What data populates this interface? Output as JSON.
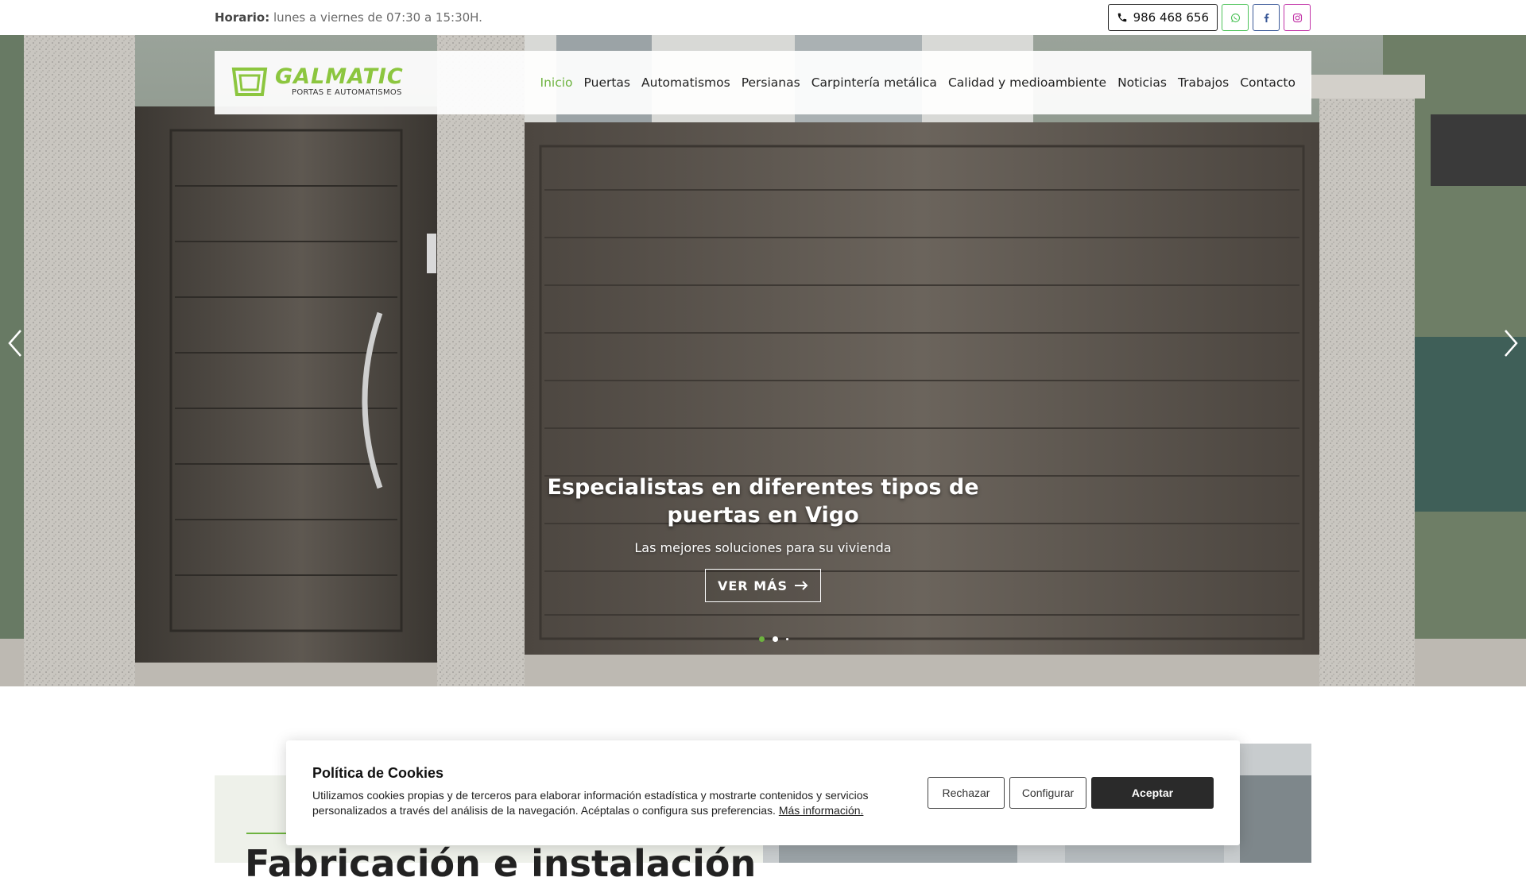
{
  "topbar": {
    "hours_label": "Horario:",
    "hours_text": "lunes a viernes de 07:30 a 15:30H.",
    "phone": "986 468 656",
    "social": [
      "whatsapp-icon",
      "facebook-icon",
      "instagram-icon"
    ]
  },
  "brand": {
    "name": "GALMATIC",
    "tagline": "PORTAS E AUTOMATISMOS",
    "accent_color": "#6db33f"
  },
  "nav": {
    "items": [
      {
        "label": "Inicio",
        "active": true
      },
      {
        "label": "Puertas"
      },
      {
        "label": "Automatismos"
      },
      {
        "label": "Persianas"
      },
      {
        "label": "Carpintería metálica"
      },
      {
        "label": "Calidad y medioambiente"
      },
      {
        "label": "Noticias"
      },
      {
        "label": "Trabajos"
      },
      {
        "label": "Contacto"
      }
    ]
  },
  "hero": {
    "title": "Especialistas en diferentes tipos de puertas en Vigo",
    "subtitle": "Las mejores soluciones para su vivienda",
    "cta_label": "VER MÁS",
    "slides_total": 3,
    "active_slide": 1
  },
  "section": {
    "heading_partial": "Fabricación e instalación"
  },
  "cookies": {
    "title": "Política de Cookies",
    "text": "Utilizamos cookies propias y de terceros para elaborar información estadística y mostrarte contenidos y servicios personalizados a través del análisis de la navegación. Acéptalas o configura sus preferencias.",
    "more_link": "Más información.",
    "reject_label": "Rechazar",
    "configure_label": "Configurar",
    "accept_label": "Aceptar"
  }
}
